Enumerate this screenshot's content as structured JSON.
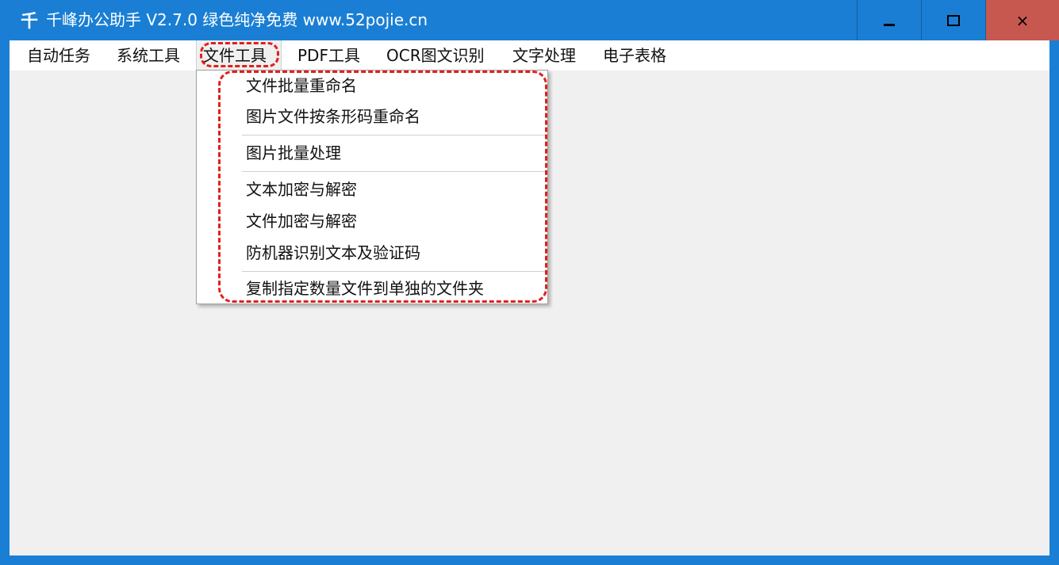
{
  "window": {
    "title": "千峰办公助手 V2.7.0  绿色纯净免费  www.52pojie.cn",
    "icon_glyph": "千",
    "controls": {
      "minimize": "minimize-icon",
      "maximize": "maximize-icon",
      "close": "×"
    },
    "colors": {
      "titlebar": "#1a7fd4",
      "close": "#c7584f",
      "highlight": "#e0201c"
    }
  },
  "menu": {
    "items": [
      {
        "label": "自动任务"
      },
      {
        "label": "系统工具"
      },
      {
        "label": "文件工具",
        "active": true
      },
      {
        "label": "PDF工具"
      },
      {
        "label": "OCR图文识别"
      },
      {
        "label": "文字处理"
      },
      {
        "label": "电子表格"
      }
    ]
  },
  "dropdown": {
    "items": [
      "文件批量重命名",
      "图片文件按条形码重命名",
      "图片批量处理",
      "文本加密与解密",
      "文件加密与解密",
      "防机器识别文本及验证码",
      "复制指定数量文件到单独的文件夹"
    ]
  }
}
